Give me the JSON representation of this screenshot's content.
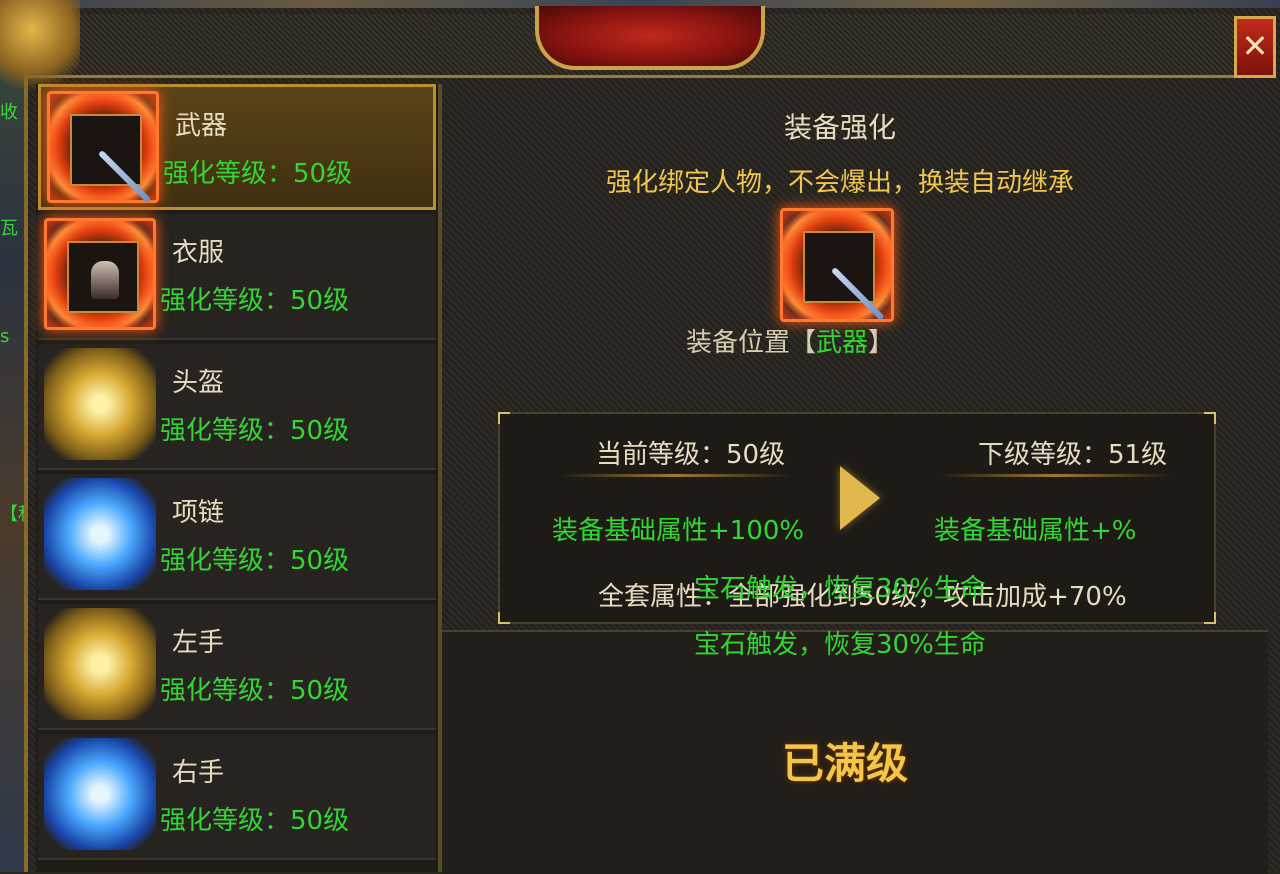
{
  "window": {
    "title": "装备强化",
    "subtitle": "强化绑定人物，不会爆出，换装自动继承",
    "close_label": "✕"
  },
  "side_hud": {
    "text_1": "收",
    "text_2": "瓦",
    "text_3": "s",
    "text_4": "【私"
  },
  "equipment_list": [
    {
      "name": "武器",
      "level": "强化等级：50级",
      "icon": "sword-icon",
      "selected": true
    },
    {
      "name": "衣服",
      "level": "强化等级：50级",
      "icon": "robe-icon",
      "selected": false
    },
    {
      "name": "头盔",
      "level": "强化等级：50级",
      "icon": "helmet-icon",
      "selected": false
    },
    {
      "name": "项链",
      "level": "强化等级：50级",
      "icon": "necklace-icon",
      "selected": false
    },
    {
      "name": "左手",
      "level": "强化等级：50级",
      "icon": "left-bracer-icon",
      "selected": false
    },
    {
      "name": "右手",
      "level": "强化等级：50级",
      "icon": "right-bracer-icon",
      "selected": false
    }
  ],
  "detail": {
    "position_prefix": "装备位置【",
    "position_value": "武器",
    "position_suffix": "】",
    "current_level": "当前等级：50级",
    "next_level": "下级等级：51级",
    "current_attr": "装备基础属性+100%",
    "next_attr": "装备基础属性+%",
    "set_attr": "全套属性：全部强化到50级，攻击加成+70%",
    "gem_effect_1": "宝石触发，恢复30%生命",
    "gem_effect_2": "宝石触发，恢复30%生命",
    "max_level": "已满级"
  },
  "colors": {
    "green_text": "#33d633",
    "gold_text": "#f0c650",
    "frame_gold": "#b8902e",
    "close_red": "#c22a1c"
  }
}
